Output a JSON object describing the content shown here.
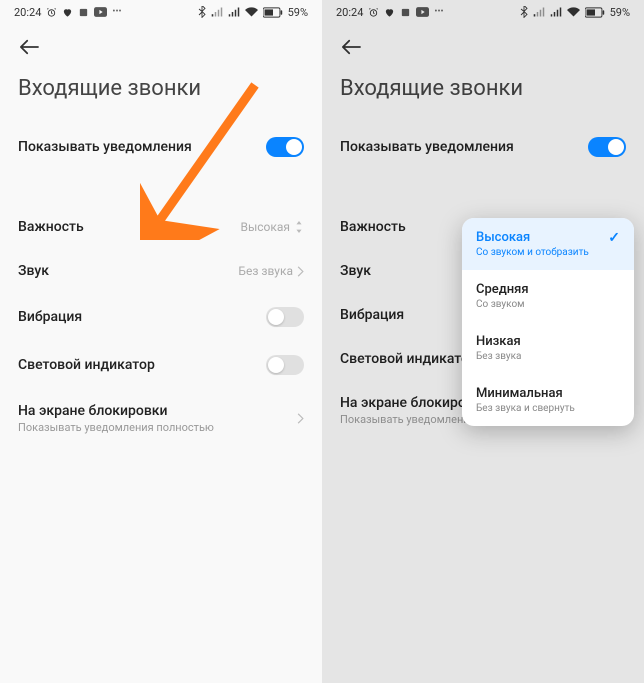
{
  "status": {
    "time": "20:24",
    "battery": "59%"
  },
  "page": {
    "title": "Входящие звонки",
    "show_notifications": "Показывать уведомления",
    "importance": {
      "label": "Важность",
      "value": "Высокая"
    },
    "sound": {
      "label": "Звук",
      "value": "Без звука"
    },
    "vibration": "Вибрация",
    "led": "Световой индикатор",
    "lockscreen": {
      "label": "На экране блокировки",
      "sub": "Показывать уведомления полностью"
    }
  },
  "popup": {
    "opt1": {
      "title": "Высокая",
      "sub": "Со звуком и отобразить"
    },
    "opt2": {
      "title": "Средняя",
      "sub": "Со звуком"
    },
    "opt3": {
      "title": "Низкая",
      "sub": "Без звука"
    },
    "opt4": {
      "title": "Минимальная",
      "sub": "Без звука и свернуть"
    }
  }
}
